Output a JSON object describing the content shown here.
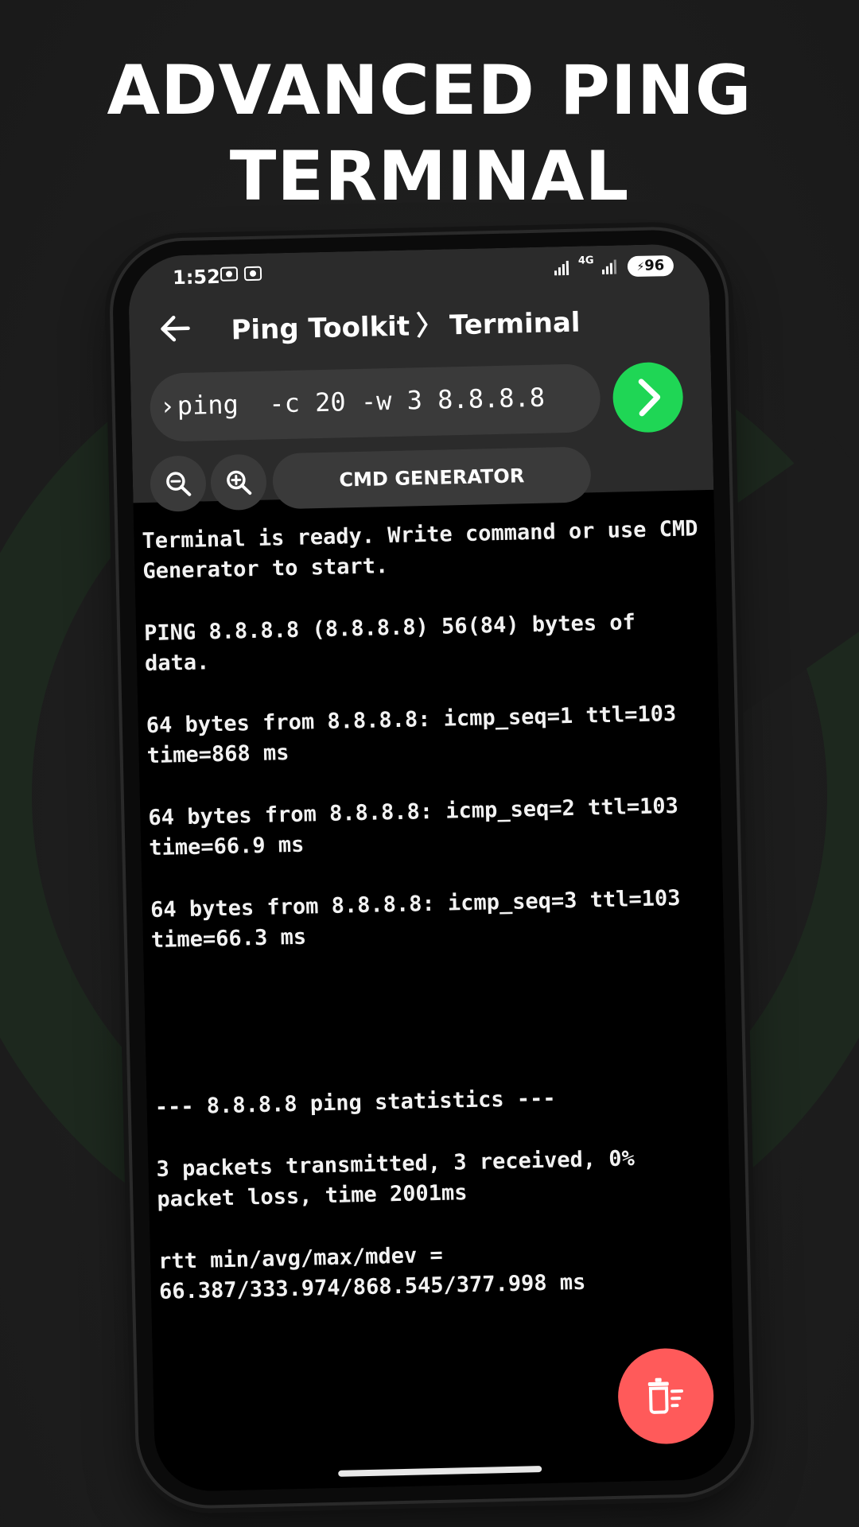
{
  "headline": {
    "line1": "ADVANCED PING",
    "line2": "TERMINAL"
  },
  "status_bar": {
    "time": "1:52",
    "network": "4G",
    "battery": "96"
  },
  "app_bar": {
    "title": "Ping Toolkit",
    "separator": "〉",
    "subtitle": "Terminal"
  },
  "command": {
    "prompt": "›",
    "value": "ping  -c 20 -w 3 8.8.8.8"
  },
  "tools": {
    "generator_label": "CMD GENERATOR"
  },
  "terminal": {
    "ready_line": "Terminal is ready. Write command or use CMD Generator to start.",
    "ping_header": "PING 8.8.8.8 (8.8.8.8) 56(84) bytes of data.",
    "replies": [
      "64 bytes from 8.8.8.8: icmp_seq=1 ttl=103 time=868 ms",
      "64 bytes from 8.8.8.8: icmp_seq=2 ttl=103 time=66.9 ms",
      "64 bytes from 8.8.8.8: icmp_seq=3 ttl=103 time=66.3 ms"
    ],
    "stats_header": "--- 8.8.8.8 ping statistics ---",
    "stats_summary": "3 packets transmitted, 3 received, 0% packet loss, time 2001ms",
    "rtt": "rtt min/avg/max/mdev = 66.387/333.974/868.545/377.998 ms"
  },
  "colors": {
    "run_button": "#1fd655",
    "clear_button": "#ff5a5a",
    "topbar": "#2b2b2b"
  }
}
